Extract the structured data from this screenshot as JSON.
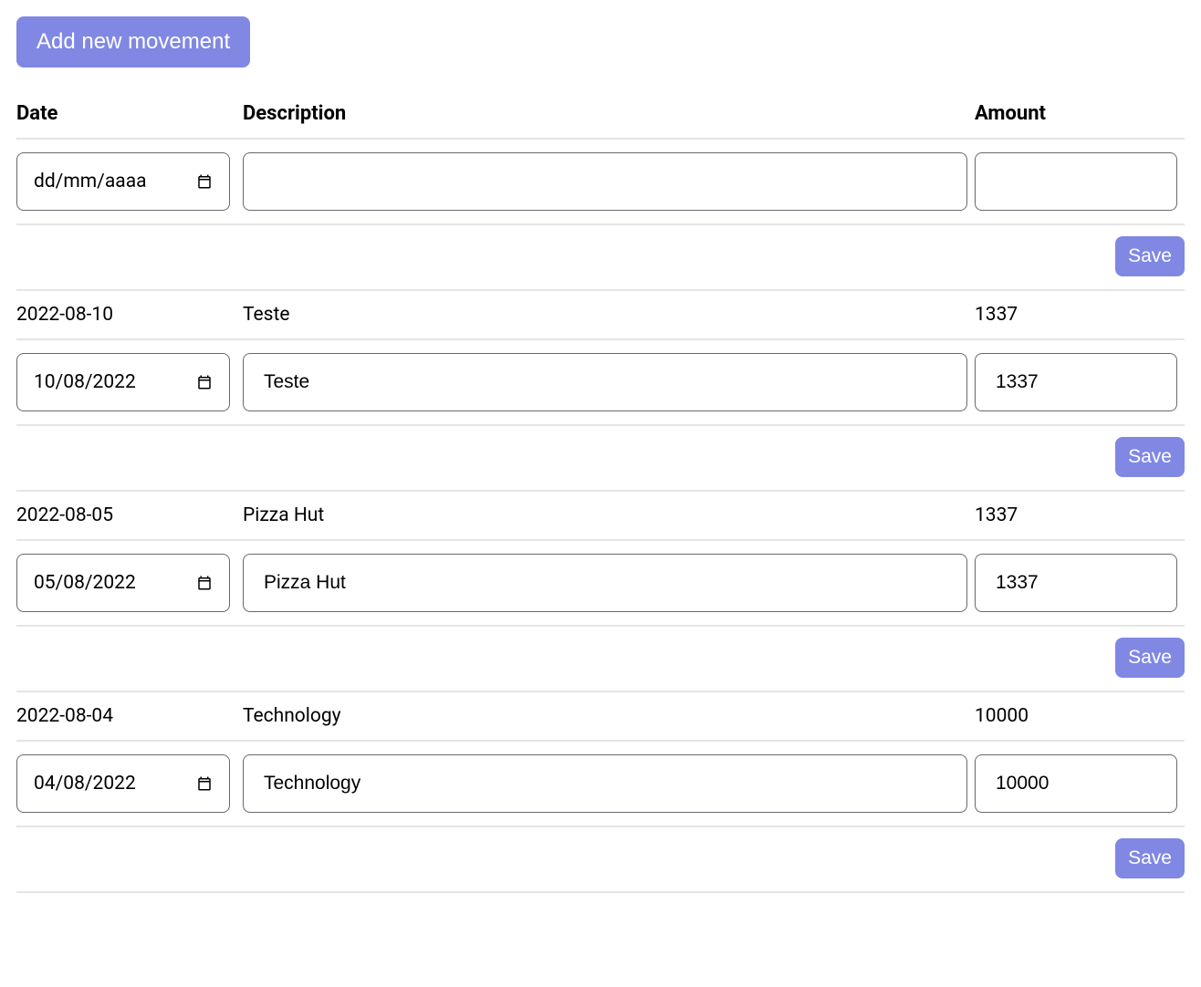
{
  "buttons": {
    "add": "Add new movement",
    "save": "Save"
  },
  "headers": {
    "date": "Date",
    "description": "Description",
    "amount": "Amount"
  },
  "date_placeholder": "dd/mm/aaaa",
  "rows": [
    {
      "date_display": "",
      "description_display": "",
      "amount_display": "",
      "date_input": "",
      "description_input": "",
      "amount_input": ""
    },
    {
      "date_display": "2022-08-10",
      "description_display": "Teste",
      "amount_display": "1337",
      "date_input": "10/08/2022",
      "description_input": "Teste",
      "amount_input": "1337"
    },
    {
      "date_display": "2022-08-05",
      "description_display": "Pizza Hut",
      "amount_display": "1337",
      "date_input": "05/08/2022",
      "description_input": "Pizza Hut",
      "amount_input": "1337"
    },
    {
      "date_display": "2022-08-04",
      "description_display": "Technology",
      "amount_display": "10000",
      "date_input": "04/08/2022",
      "description_input": "Technology",
      "amount_input": "10000"
    }
  ]
}
